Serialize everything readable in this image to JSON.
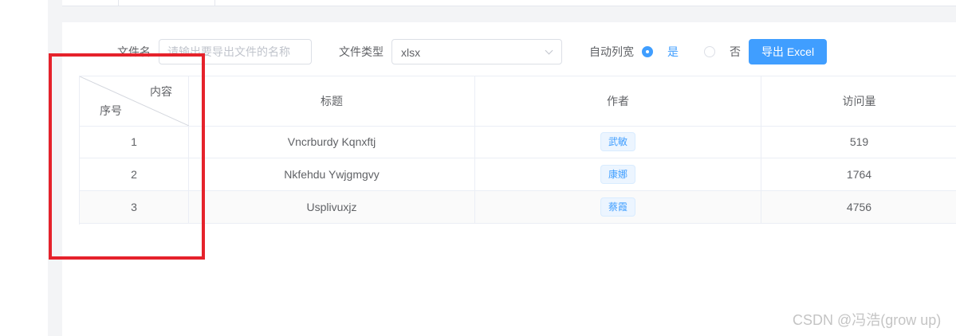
{
  "toolbar": {
    "filename_label": "文件名",
    "filename_placeholder": "请输出要导出文件的名称",
    "filetype_label": "文件类型",
    "filetype_value": "xlsx",
    "autowidth_label": "自动列宽",
    "radio_yes": "是",
    "radio_no": "否",
    "export_button": "导出 Excel"
  },
  "table": {
    "corner_top": "内容",
    "corner_bottom": "序号",
    "columns": [
      "标题",
      "作者",
      "访问量"
    ],
    "rows": [
      {
        "index": "1",
        "title": "Vncrburdy Kqnxftj",
        "author": "武敏",
        "views": "519"
      },
      {
        "index": "2",
        "title": "Nkfehdu Ywjgmgvy",
        "author": "康娜",
        "views": "1764"
      },
      {
        "index": "3",
        "title": "Usplivuxjz",
        "author": "蔡霞",
        "views": "4756"
      }
    ]
  },
  "colors": {
    "accent": "#409eff",
    "highlight_box": "#e5222b",
    "border": "#ebeef5"
  },
  "watermark": "CSDN @冯浩(grow up)"
}
